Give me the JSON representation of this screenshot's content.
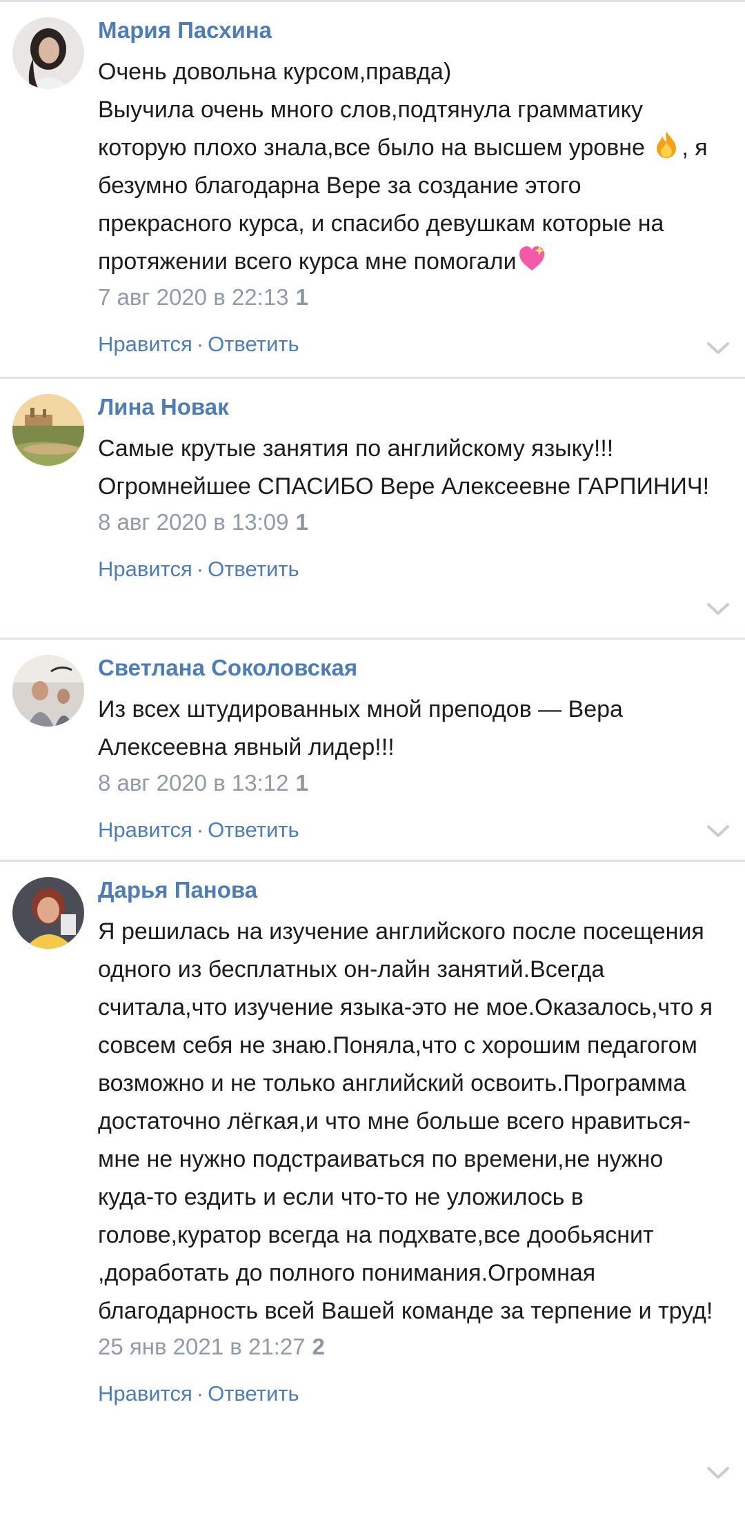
{
  "comments": [
    {
      "author": "Мария Пасхина",
      "lines": [
        "Очень довольна курсом,правда)",
        "Выучила очень много слов,подтянула грамматику которую плохо знала,все было на высшем уровне",
        ", я безумно благодарна Вере за создание этого прекрасного курса, и спасибо девушкам которые на протяжении всего курса мне помогали"
      ],
      "emoji": [
        "fire-emoji",
        "sparkling-heart-emoji"
      ],
      "date": "7 авг 2020 в 22:13",
      "likes": "1",
      "like_label": "Нравится",
      "separator": "·",
      "reply_label": "Ответить"
    },
    {
      "author": "Лина Новак",
      "text": "Самые крутые занятия по английскому языку!!! Огромнейшее СПАСИБО Вере Алексеевне ГАРПИНИЧ!",
      "date": "8 авг 2020 в 13:09",
      "likes": "1",
      "like_label": "Нравится",
      "separator": "·",
      "reply_label": "Ответить"
    },
    {
      "author": "Светлана Соколовская",
      "text": "Из всех штудированных мной преподов — Вера Алексеевна явный лидер!!!",
      "date": "8 авг 2020 в 13:12",
      "likes": "1",
      "like_label": "Нравится",
      "separator": "·",
      "reply_label": "Ответить"
    },
    {
      "author": "Дарья Панова",
      "text": "Я решилась на изучение английского после посещения одного из бесплатных он-лайн занятий.Всегда считала,что изучение языка-это не мое.Оказалось,что я совсем себя не знаю.Поняла,что с хорошим педагогом возможно и не только английский освоить.Программа достаточно лёгкая,и что мне больше всего нравиться- мне не нужно подстраиваться по времени,не нужно куда-то ездить и если что-то не уложилось в голове,куратор всегда на подхвате,все дообьяснит ,доработать до полного понимания.Огромная благодарность всей Вашей команде за терпение и труд!",
      "date": "25 янв 2021 в 21:27",
      "likes": "2",
      "like_label": "Нравится",
      "separator": "·",
      "reply_label": "Ответить"
    }
  ],
  "colors": {
    "link": "#4f7db3",
    "meta": "#919aa5",
    "divider": "#dfe3e8"
  },
  "icons": [
    "chevron-down-icon",
    "fire-emoji",
    "sparkling-heart-emoji"
  ]
}
